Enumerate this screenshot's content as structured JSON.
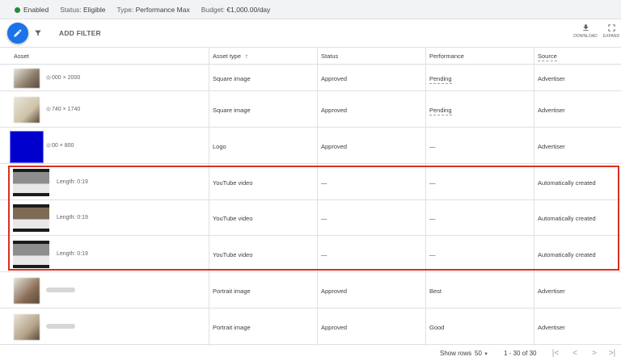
{
  "status_bar": {
    "enabled_label": "Enabled",
    "enabled_color": "#1e8e3e",
    "status_prefix": "Status:",
    "status_value": "Eligible",
    "type_prefix": "Type:",
    "type_value": "Performance Max",
    "budget_prefix": "Budget:",
    "budget_value": "€1,000.00/day"
  },
  "toolbar": {
    "edit_icon": "pencil-icon",
    "edit_color": "#1a73e8",
    "add_filter_label": "ADD FILTER",
    "download_label": "DOWNLOAD",
    "expand_label": "EXPAND"
  },
  "table": {
    "columns": {
      "asset": "Asset",
      "asset_type": "Asset type",
      "asset_type_sort": "↑",
      "status": "Status",
      "performance": "Performance",
      "source": "Source"
    },
    "rows": [
      {
        "thumb_color": "#8a7a68",
        "thumb_kind": "image",
        "label": "000 × 2000",
        "type": "Square image",
        "status": "Approved",
        "performance": "Pending",
        "source": "Advertiser"
      },
      {
        "thumb_color": "#cfc3a8",
        "thumb_kind": "image",
        "label": "740 × 1740",
        "type": "Square image",
        "status": "Approved",
        "performance": "Pending",
        "source": "Advertiser"
      },
      {
        "thumb_color": "#0000cc",
        "thumb_kind": "logo",
        "label": "00 × 800",
        "type": "Logo",
        "status": "Approved",
        "performance": "—",
        "source": "Advertiser"
      },
      {
        "thumb_color": "#8d8d8d",
        "thumb_kind": "video",
        "label": "Length: 0:19",
        "type": "YouTube video",
        "status": "—",
        "performance": "—",
        "source": "Automatically created"
      },
      {
        "thumb_color": "#7d6a55",
        "thumb_kind": "video",
        "label": "Length: 0:19",
        "type": "YouTube video",
        "status": "—",
        "performance": "—",
        "source": "Automatically created"
      },
      {
        "thumb_color": "#8d8d8d",
        "thumb_kind": "video",
        "label": "Length: 0:19",
        "type": "YouTube video",
        "status": "—",
        "performance": "—",
        "source": "Automatically created"
      },
      {
        "thumb_color": "#8b6e58",
        "thumb_kind": "image",
        "label": "",
        "type": "Portrait image",
        "status": "Approved",
        "performance": "Best",
        "source": "Advertiser"
      },
      {
        "thumb_color": "#b6a48a",
        "thumb_kind": "image",
        "label": "",
        "type": "Portrait image",
        "status": "Approved",
        "performance": "Good",
        "source": "Advertiser"
      }
    ]
  },
  "footer": {
    "show_rows_label": "Show rows",
    "rows_value": "50",
    "range": "1 - 30 of 30"
  },
  "highlight_color": "#d93025"
}
